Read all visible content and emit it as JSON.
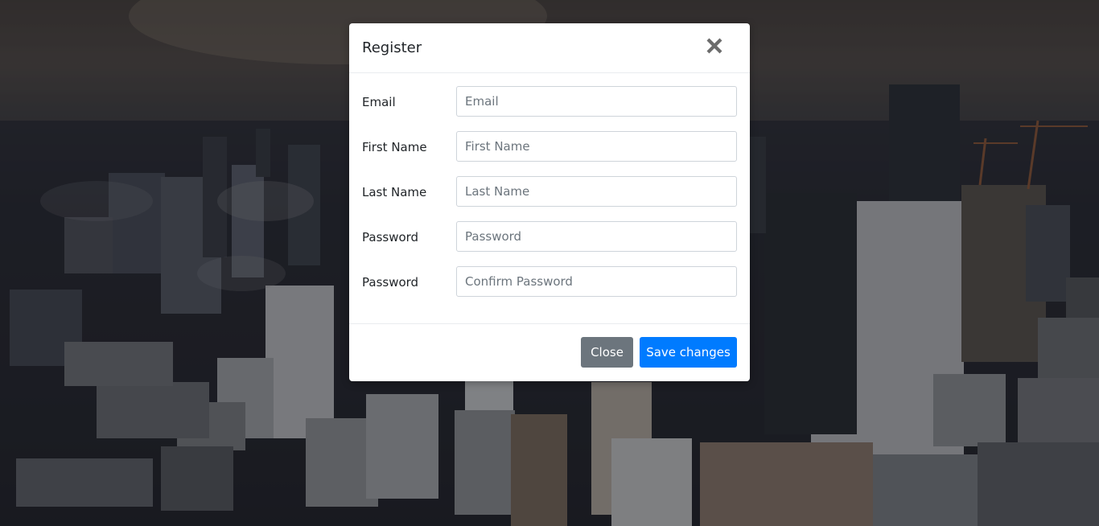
{
  "modal": {
    "title": "Register",
    "close_icon": "close-icon",
    "fields": [
      {
        "label": "Email",
        "placeholder": "Email",
        "value": ""
      },
      {
        "label": "First Name",
        "placeholder": "First Name",
        "value": ""
      },
      {
        "label": "Last Name",
        "placeholder": "Last Name",
        "value": ""
      },
      {
        "label": "Password",
        "placeholder": "Password",
        "value": ""
      },
      {
        "label": "Password",
        "placeholder": "Confirm Password",
        "value": ""
      }
    ],
    "footer": {
      "close_label": "Close",
      "save_label": "Save changes"
    }
  },
  "colors": {
    "primary": "#007bff",
    "secondary": "#6c757d",
    "overlay": "#000000"
  }
}
